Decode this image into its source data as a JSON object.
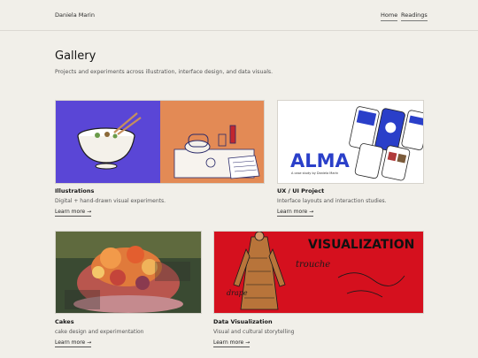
{
  "header": {
    "site_name": "Daniela Marin",
    "nav": [
      "Home",
      "Readings"
    ]
  },
  "page": {
    "title": "Gallery",
    "subtitle": "Projects and experiments across illustration, interface design, and data visuals."
  },
  "cards": [
    {
      "title": "Illustrations",
      "desc": "Digital + hand-drawn visual experiments.",
      "link": "Learn more →"
    },
    {
      "title": "UX / UI Project",
      "desc": "Interface layouts and interaction studies.",
      "link": "Learn more →",
      "thumb_text": {
        "brand": "ALMA",
        "caption": "A case study by Daniela Marin"
      }
    },
    {
      "title": "Cakes",
      "desc": "cake design and experimentation",
      "link": "Learn more →"
    },
    {
      "title": "Data Visualization",
      "desc": "Visual and cultural storytelling",
      "link": "Learn more →",
      "thumb_text": {
        "headline": "VISUALIZATION",
        "word1": "trouche",
        "word2": "drape"
      }
    }
  ],
  "colors": {
    "background": "#f1efe9",
    "illustration_left": "#5a46d6",
    "illustration_right": "#e38a55",
    "alma_blue": "#2a3fc9",
    "dataviz_red": "#d5101e"
  }
}
